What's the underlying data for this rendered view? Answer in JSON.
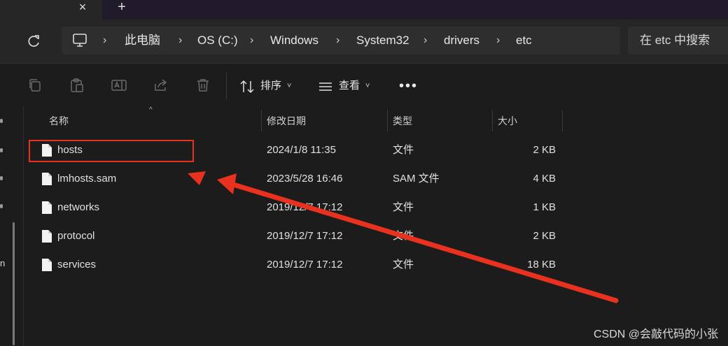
{
  "window": {
    "close_glyph": "×",
    "new_tab_glyph": "+"
  },
  "address": {
    "breadcrumbs": [
      "此电脑",
      "OS (C:)",
      "Windows",
      "System32",
      "drivers",
      "etc"
    ],
    "separator": "›"
  },
  "search": {
    "placeholder": "在 etc 中搜索"
  },
  "toolbar": {
    "sort_label": "排序",
    "view_label": "查看",
    "caret": "˅",
    "more": "•••"
  },
  "columns": {
    "name": "名称",
    "modified": "修改日期",
    "type": "类型",
    "size": "大小",
    "sort_glyph": "^"
  },
  "files": [
    {
      "name": "hosts",
      "modified": "2024/1/8 11:35",
      "type": "文件",
      "size": "2 KB"
    },
    {
      "name": "lmhosts.sam",
      "modified": "2023/5/28 16:46",
      "type": "SAM 文件",
      "size": "4 KB"
    },
    {
      "name": "networks",
      "modified": "2019/12/7 17:12",
      "type": "文件",
      "size": "1 KB"
    },
    {
      "name": "protocol",
      "modified": "2019/12/7 17:12",
      "type": "文件",
      "size": "2 KB"
    },
    {
      "name": "services",
      "modified": "2019/12/7 17:12",
      "type": "文件",
      "size": "18 KB"
    }
  ],
  "left_pane": {
    "partial_text": "n"
  },
  "watermark": "CSDN @会敲代码的小张",
  "colors": {
    "annotation": "#e8321f",
    "background": "#1c1c1c"
  },
  "icons": [
    "copy-icon",
    "paste-icon",
    "rename-icon",
    "share-icon",
    "delete-icon",
    "sort-icon",
    "view-icon",
    "refresh-icon",
    "this-pc-icon",
    "file-icon"
  ]
}
